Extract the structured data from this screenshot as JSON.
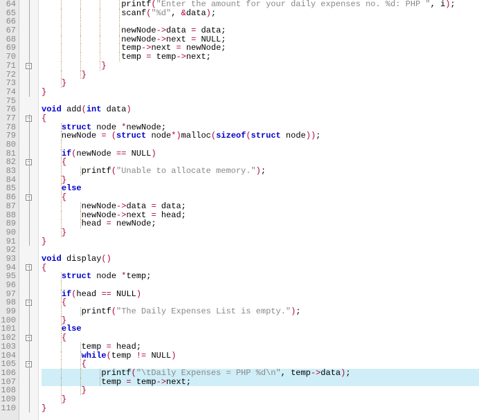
{
  "lines": [
    {
      "n": 64,
      "fold": "v",
      "indent": 4,
      "hl": false,
      "segs": [
        [
          "                ",
          ""
        ],
        [
          "printf",
          ""
        ],
        [
          "(",
          "op"
        ],
        [
          "\"Enter the amount for your daily expenses no. %d: PHP \"",
          "str"
        ],
        [
          ", i",
          ""
        ],
        [
          ")",
          "op"
        ],
        [
          ";",
          ""
        ]
      ]
    },
    {
      "n": 65,
      "fold": "v",
      "indent": 4,
      "hl": false,
      "segs": [
        [
          "                ",
          ""
        ],
        [
          "scanf",
          ""
        ],
        [
          "(",
          "op"
        ],
        [
          "\"%d\"",
          "str"
        ],
        [
          ", ",
          ""
        ],
        [
          "&",
          "op"
        ],
        [
          "data",
          ""
        ],
        [
          ")",
          "op"
        ],
        [
          ";",
          ""
        ]
      ]
    },
    {
      "n": 66,
      "fold": "v",
      "indent": 4,
      "hl": false,
      "segs": []
    },
    {
      "n": 67,
      "fold": "v",
      "indent": 4,
      "hl": false,
      "segs": [
        [
          "                newNode",
          ""
        ],
        [
          "->",
          "op"
        ],
        [
          "data ",
          ""
        ],
        [
          "=",
          "op"
        ],
        [
          " data;",
          ""
        ]
      ]
    },
    {
      "n": 68,
      "fold": "v",
      "indent": 4,
      "hl": false,
      "segs": [
        [
          "                newNode",
          ""
        ],
        [
          "->",
          "op"
        ],
        [
          "next ",
          ""
        ],
        [
          "=",
          "op"
        ],
        [
          " NULL;",
          ""
        ]
      ]
    },
    {
      "n": 69,
      "fold": "v",
      "indent": 4,
      "hl": false,
      "segs": [
        [
          "                temp",
          ""
        ],
        [
          "->",
          "op"
        ],
        [
          "next ",
          ""
        ],
        [
          "=",
          "op"
        ],
        [
          " newNode;",
          ""
        ]
      ]
    },
    {
      "n": 70,
      "fold": "v",
      "indent": 4,
      "hl": false,
      "segs": [
        [
          "                temp ",
          ""
        ],
        [
          "=",
          "op"
        ],
        [
          " temp",
          ""
        ],
        [
          "->",
          "op"
        ],
        [
          "next;",
          ""
        ]
      ]
    },
    {
      "n": 71,
      "fold": "box",
      "indent": 3,
      "hl": false,
      "segs": [
        [
          "            ",
          ""
        ],
        [
          "}",
          "op"
        ]
      ]
    },
    {
      "n": 72,
      "fold": "v",
      "indent": 2,
      "hl": false,
      "segs": [
        [
          "        ",
          ""
        ],
        [
          "}",
          "op"
        ]
      ]
    },
    {
      "n": 73,
      "fold": "v",
      "indent": 1,
      "hl": false,
      "segs": [
        [
          "    ",
          ""
        ],
        [
          "}",
          "op"
        ]
      ]
    },
    {
      "n": 74,
      "fold": "v",
      "indent": 0,
      "hl": false,
      "segs": [
        [
          "}",
          "op"
        ]
      ]
    },
    {
      "n": 75,
      "fold": "",
      "indent": 0,
      "hl": false,
      "segs": []
    },
    {
      "n": 76,
      "fold": "",
      "indent": 0,
      "hl": false,
      "segs": [
        [
          "void",
          "kw"
        ],
        [
          " add",
          ""
        ],
        [
          "(",
          "op"
        ],
        [
          "int",
          "kw"
        ],
        [
          " data",
          ""
        ],
        [
          ")",
          "op"
        ]
      ]
    },
    {
      "n": 77,
      "fold": "box",
      "indent": 0,
      "hl": false,
      "segs": [
        [
          "{",
          "op"
        ]
      ]
    },
    {
      "n": 78,
      "fold": "v",
      "indent": 1,
      "hl": false,
      "segs": [
        [
          "    ",
          ""
        ],
        [
          "struct",
          "kw"
        ],
        [
          " node ",
          ""
        ],
        [
          "*",
          "op"
        ],
        [
          "newNode;",
          ""
        ]
      ]
    },
    {
      "n": 79,
      "fold": "v",
      "indent": 1,
      "hl": false,
      "segs": [
        [
          "    newNode ",
          ""
        ],
        [
          "=",
          "op"
        ],
        [
          " ",
          ""
        ],
        [
          "(",
          "op"
        ],
        [
          "struct",
          "kw"
        ],
        [
          " node",
          ""
        ],
        [
          "*",
          "op"
        ],
        [
          ")",
          "op"
        ],
        [
          "malloc",
          ""
        ],
        [
          "(",
          "op"
        ],
        [
          "sizeof",
          "kw"
        ],
        [
          "(",
          "op"
        ],
        [
          "struct",
          "kw"
        ],
        [
          " node",
          ""
        ],
        [
          "))",
          "op"
        ],
        [
          ";",
          ""
        ]
      ]
    },
    {
      "n": 80,
      "fold": "v",
      "indent": 1,
      "hl": false,
      "segs": []
    },
    {
      "n": 81,
      "fold": "v",
      "indent": 1,
      "hl": false,
      "segs": [
        [
          "    ",
          ""
        ],
        [
          "if",
          "kw"
        ],
        [
          "(",
          "op"
        ],
        [
          "newNode ",
          ""
        ],
        [
          "==",
          "op"
        ],
        [
          " NULL",
          ""
        ],
        [
          ")",
          "op"
        ]
      ]
    },
    {
      "n": 82,
      "fold": "box",
      "indent": 1,
      "hl": false,
      "segs": [
        [
          "    ",
          ""
        ],
        [
          "{",
          "op"
        ]
      ]
    },
    {
      "n": 83,
      "fold": "v",
      "indent": 2,
      "hl": false,
      "segs": [
        [
          "        printf",
          ""
        ],
        [
          "(",
          "op"
        ],
        [
          "\"Unable to allocate memory.\"",
          "str"
        ],
        [
          ")",
          "op"
        ],
        [
          ";",
          ""
        ]
      ]
    },
    {
      "n": 84,
      "fold": "v",
      "indent": 1,
      "hl": false,
      "segs": [
        [
          "    ",
          ""
        ],
        [
          "}",
          "op"
        ]
      ]
    },
    {
      "n": 85,
      "fold": "v",
      "indent": 1,
      "hl": false,
      "segs": [
        [
          "    ",
          ""
        ],
        [
          "else",
          "kw"
        ]
      ]
    },
    {
      "n": 86,
      "fold": "box",
      "indent": 1,
      "hl": false,
      "segs": [
        [
          "    ",
          ""
        ],
        [
          "{",
          "op"
        ]
      ]
    },
    {
      "n": 87,
      "fold": "v",
      "indent": 2,
      "hl": false,
      "segs": [
        [
          "        newNode",
          ""
        ],
        [
          "->",
          "op"
        ],
        [
          "data ",
          ""
        ],
        [
          "=",
          "op"
        ],
        [
          " data;",
          ""
        ]
      ]
    },
    {
      "n": 88,
      "fold": "v",
      "indent": 2,
      "hl": false,
      "segs": [
        [
          "        newNode",
          ""
        ],
        [
          "->",
          "op"
        ],
        [
          "next ",
          ""
        ],
        [
          "=",
          "op"
        ],
        [
          " head;",
          ""
        ]
      ]
    },
    {
      "n": 89,
      "fold": "v",
      "indent": 2,
      "hl": false,
      "segs": [
        [
          "        head ",
          ""
        ],
        [
          "=",
          "op"
        ],
        [
          " newNode;",
          ""
        ]
      ]
    },
    {
      "n": 90,
      "fold": "v",
      "indent": 1,
      "hl": false,
      "segs": [
        [
          "    ",
          ""
        ],
        [
          "}",
          "op"
        ]
      ]
    },
    {
      "n": 91,
      "fold": "v",
      "indent": 0,
      "hl": false,
      "segs": [
        [
          "}",
          "op"
        ]
      ]
    },
    {
      "n": 92,
      "fold": "",
      "indent": 0,
      "hl": false,
      "segs": []
    },
    {
      "n": 93,
      "fold": "",
      "indent": 0,
      "hl": false,
      "segs": [
        [
          "void",
          "kw"
        ],
        [
          " display",
          ""
        ],
        [
          "()",
          "op"
        ]
      ]
    },
    {
      "n": 94,
      "fold": "box",
      "indent": 0,
      "hl": false,
      "segs": [
        [
          "{",
          "op"
        ]
      ]
    },
    {
      "n": 95,
      "fold": "v",
      "indent": 1,
      "hl": false,
      "segs": [
        [
          "    ",
          ""
        ],
        [
          "struct",
          "kw"
        ],
        [
          " node ",
          ""
        ],
        [
          "*",
          "op"
        ],
        [
          "temp;",
          ""
        ]
      ]
    },
    {
      "n": 96,
      "fold": "v",
      "indent": 1,
      "hl": false,
      "segs": []
    },
    {
      "n": 97,
      "fold": "v",
      "indent": 1,
      "hl": false,
      "segs": [
        [
          "    ",
          ""
        ],
        [
          "if",
          "kw"
        ],
        [
          "(",
          "op"
        ],
        [
          "head ",
          ""
        ],
        [
          "==",
          "op"
        ],
        [
          " NULL",
          ""
        ],
        [
          ")",
          "op"
        ]
      ]
    },
    {
      "n": 98,
      "fold": "box",
      "indent": 1,
      "hl": false,
      "segs": [
        [
          "    ",
          ""
        ],
        [
          "{",
          "op"
        ]
      ]
    },
    {
      "n": 99,
      "fold": "v",
      "indent": 2,
      "hl": false,
      "segs": [
        [
          "        printf",
          ""
        ],
        [
          "(",
          "op"
        ],
        [
          "\"The Daily Expenses List is empty.\"",
          "str"
        ],
        [
          ")",
          "op"
        ],
        [
          ";",
          ""
        ]
      ]
    },
    {
      "n": 100,
      "fold": "v",
      "indent": 1,
      "hl": false,
      "segs": [
        [
          "    ",
          ""
        ],
        [
          "}",
          "op"
        ]
      ]
    },
    {
      "n": 101,
      "fold": "v",
      "indent": 1,
      "hl": false,
      "segs": [
        [
          "    ",
          ""
        ],
        [
          "else",
          "kw"
        ]
      ]
    },
    {
      "n": 102,
      "fold": "box",
      "indent": 1,
      "hl": false,
      "segs": [
        [
          "    ",
          ""
        ],
        [
          "{",
          "op"
        ]
      ]
    },
    {
      "n": 103,
      "fold": "v",
      "indent": 2,
      "hl": false,
      "segs": [
        [
          "        temp ",
          ""
        ],
        [
          "=",
          "op"
        ],
        [
          " head;",
          ""
        ]
      ]
    },
    {
      "n": 104,
      "fold": "v",
      "indent": 2,
      "hl": false,
      "segs": [
        [
          "        ",
          ""
        ],
        [
          "while",
          "kw"
        ],
        [
          "(",
          "op"
        ],
        [
          "temp ",
          ""
        ],
        [
          "!=",
          "op"
        ],
        [
          " NULL",
          ""
        ],
        [
          ")",
          "op"
        ]
      ]
    },
    {
      "n": 105,
      "fold": "box",
      "indent": 2,
      "hl": false,
      "segs": [
        [
          "        ",
          ""
        ],
        [
          "{",
          "op"
        ]
      ]
    },
    {
      "n": 106,
      "fold": "v",
      "indent": 3,
      "hl": true,
      "segs": [
        [
          "            printf",
          ""
        ],
        [
          "(",
          "op"
        ],
        [
          "\"\\tDaily Expenses = PHP %d\\n\"",
          "str"
        ],
        [
          ", temp",
          ""
        ],
        [
          "->",
          "op"
        ],
        [
          "data",
          ""
        ],
        [
          ")",
          "op"
        ],
        [
          ";",
          ""
        ]
      ]
    },
    {
      "n": 107,
      "fold": "v",
      "indent": 3,
      "hl": true,
      "segs": [
        [
          "            temp ",
          ""
        ],
        [
          "=",
          "op"
        ],
        [
          " temp",
          ""
        ],
        [
          "->",
          "op"
        ],
        [
          "next;",
          ""
        ]
      ]
    },
    {
      "n": 108,
      "fold": "v",
      "indent": 2,
      "hl": false,
      "segs": [
        [
          "        ",
          ""
        ],
        [
          "}",
          "op"
        ]
      ]
    },
    {
      "n": 109,
      "fold": "v",
      "indent": 1,
      "hl": false,
      "segs": [
        [
          "    ",
          ""
        ],
        [
          "}",
          "op"
        ]
      ]
    },
    {
      "n": 110,
      "fold": "v",
      "indent": 0,
      "hl": false,
      "segs": [
        [
          "}",
          "op"
        ]
      ]
    }
  ]
}
